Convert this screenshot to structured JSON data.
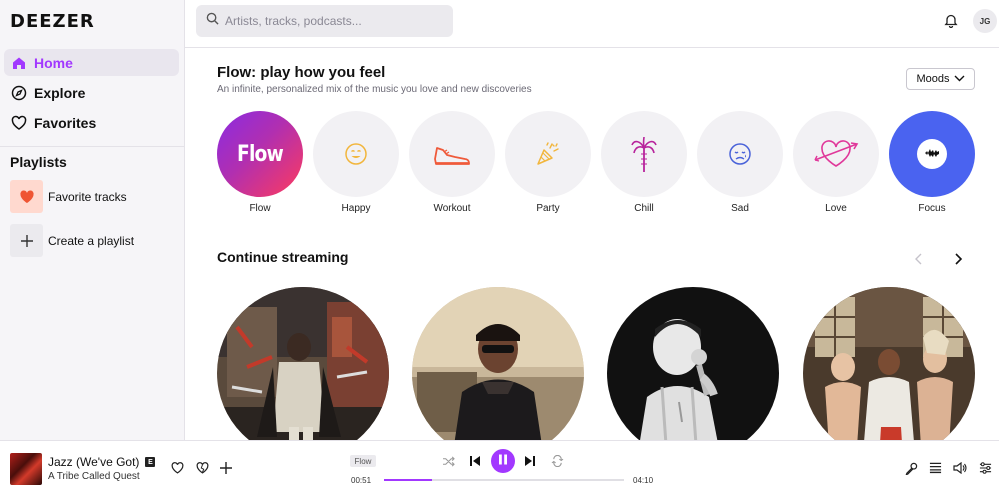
{
  "brand": {
    "logo": "DEEZER",
    "accent": "#a238ff"
  },
  "sidebar": {
    "nav": [
      {
        "label": "Home",
        "icon": "home-icon",
        "active": true
      },
      {
        "label": "Explore",
        "icon": "compass-icon",
        "active": false
      },
      {
        "label": "Favorites",
        "icon": "heart-icon",
        "active": false
      }
    ],
    "playlists_heading": "Playlists",
    "playlists": [
      {
        "label": "Favorite tracks",
        "icon": "heart-icon"
      },
      {
        "label": "Create a playlist",
        "icon": "plus-icon"
      }
    ]
  },
  "topbar": {
    "search_placeholder": "Artists, tracks, podcasts...",
    "user_initials": "JG"
  },
  "flow": {
    "title": "Flow: play how you feel",
    "subtitle": "An infinite, personalized mix of the music you love and new discoveries",
    "moods_button": "Moods",
    "moods": [
      {
        "label": "Flow",
        "badge_text": "Flow",
        "icon": "flow-badge"
      },
      {
        "label": "Happy",
        "icon": "smiley-icon"
      },
      {
        "label": "Workout",
        "icon": "sneaker-icon"
      },
      {
        "label": "Party",
        "icon": "party-popper-icon"
      },
      {
        "label": "Chill",
        "icon": "palm-tree-icon"
      },
      {
        "label": "Sad",
        "icon": "sad-face-icon"
      },
      {
        "label": "Love",
        "icon": "heart-arrow-icon"
      },
      {
        "label": "Focus",
        "icon": "focus-icon"
      }
    ]
  },
  "continue": {
    "title": "Continue streaming",
    "covers": [
      {
        "icon": "artist-photo-1"
      },
      {
        "icon": "artist-photo-2"
      },
      {
        "icon": "artist-photo-3"
      },
      {
        "icon": "artist-photo-4"
      }
    ]
  },
  "player": {
    "track": "Jazz (We've Got)",
    "explicit": "E",
    "artist": "A Tribe Called Quest",
    "source_chip": "Flow",
    "elapsed": "00:51",
    "duration": "04:10",
    "progress": 0.2
  }
}
